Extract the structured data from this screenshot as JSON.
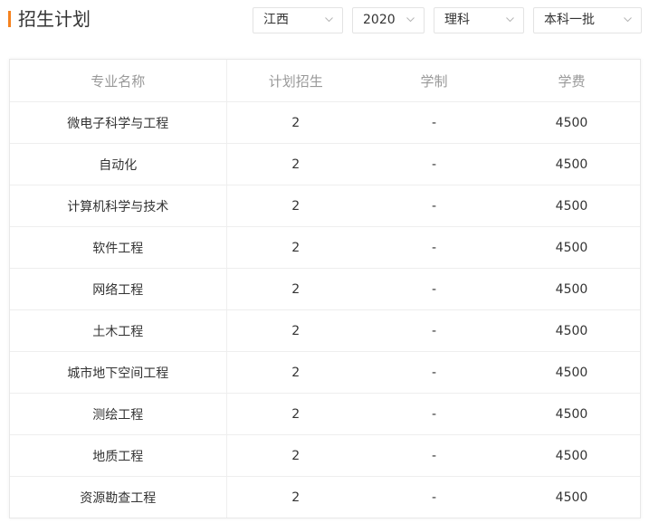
{
  "header": {
    "title": "招生计划",
    "filters": [
      {
        "value": "江西"
      },
      {
        "value": "2020"
      },
      {
        "value": "理科"
      },
      {
        "value": "本科一批"
      }
    ]
  },
  "table": {
    "columns": [
      "专业名称",
      "计划招生",
      "学制",
      "学费"
    ],
    "rows": [
      [
        "微电子科学与工程",
        "2",
        "-",
        "4500"
      ],
      [
        "自动化",
        "2",
        "-",
        "4500"
      ],
      [
        "计算机科学与技术",
        "2",
        "-",
        "4500"
      ],
      [
        "软件工程",
        "2",
        "-",
        "4500"
      ],
      [
        "网络工程",
        "2",
        "-",
        "4500"
      ],
      [
        "土木工程",
        "2",
        "-",
        "4500"
      ],
      [
        "城市地下空间工程",
        "2",
        "-",
        "4500"
      ],
      [
        "测绘工程",
        "2",
        "-",
        "4500"
      ],
      [
        "地质工程",
        "2",
        "-",
        "4500"
      ],
      [
        "资源勘查工程",
        "2",
        "-",
        "4500"
      ]
    ]
  },
  "colors": {
    "accent": "#f5821f",
    "border": "#e3e3e3",
    "header_text": "#999999"
  }
}
